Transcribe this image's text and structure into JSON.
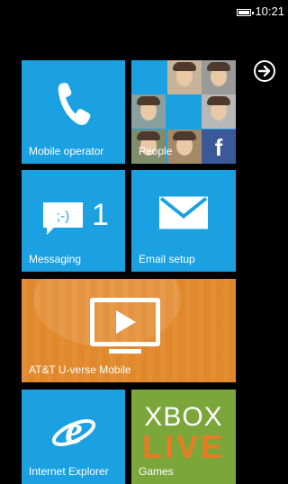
{
  "status_bar": {
    "time": "10:21",
    "battery_icon": "battery-icon"
  },
  "tiles": {
    "phone": {
      "label": "Mobile operator",
      "icon": "phone-icon"
    },
    "people": {
      "label": "People",
      "icon": "people-photos"
    },
    "messaging": {
      "label": "Messaging",
      "icon": "messaging-icon",
      "count": "1"
    },
    "email": {
      "label": "Email setup",
      "icon": "envelope-icon"
    },
    "uverse": {
      "label": "AT&T U-verse Mobile",
      "icon": "tv-play-icon"
    },
    "ie": {
      "label": "Internet Explorer",
      "icon": "internet-explorer-icon"
    },
    "xbox": {
      "label": "Games",
      "logo_top": "XBOX",
      "logo_bottom": "LIVE"
    }
  },
  "nav": {
    "arrow_icon": "arrow-right-circle-icon"
  },
  "colors": {
    "accent": "#1ba1e2",
    "uverse": "#e1882b",
    "xbox": "#7ba73a",
    "background": "#000000"
  }
}
